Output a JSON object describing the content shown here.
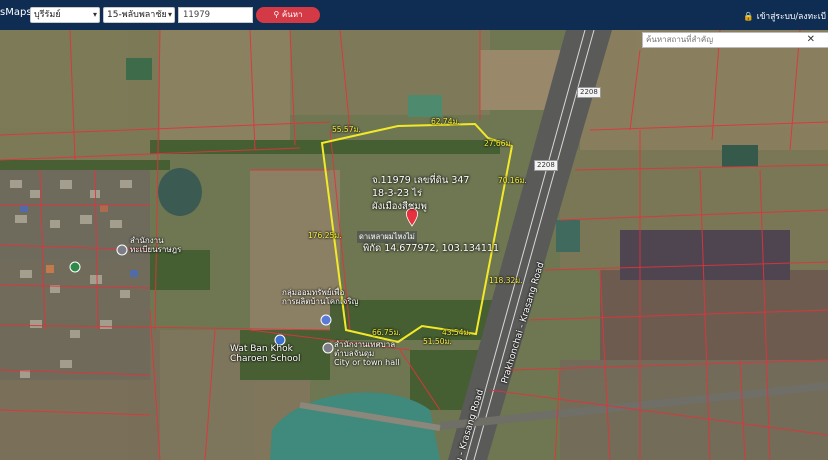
{
  "header": {
    "brand": "sMaps",
    "province_select": "บุรีรัมย์",
    "district_select": "15-พลับพลาชัย",
    "parcel_number": "11979",
    "search_button": "ค้นหา",
    "login_label": "เข้าสู่ระบบ/ลงทะเบี"
  },
  "map": {
    "place_search_placeholder": "ค้นหาสถานที่สำคัญ",
    "parcel_info": {
      "line1": "จ.11979 เลขที่ดิน 347",
      "line2": "18-3-23 ไร่",
      "line3": "ผังเมืองสีชมพู",
      "coords": "พิกัด 14.677972, 103.134111"
    },
    "marker_label": "ดาเหลาผมไหงไม่",
    "dimensions": [
      "55.57ม.",
      "62.74ม.",
      "27.66ม.",
      "70.16ม.",
      "176.25ม.",
      "118.32ม.",
      "66.75ม.",
      "43.54ม.",
      "51.50ม."
    ],
    "road_shields": [
      "2208",
      "2208"
    ],
    "road_names": [
      "Prakhonchai - Krasang Road",
      "u - Krasang Road"
    ],
    "poi_labels": {
      "poi_1": "สำนักงาน\nทะเบียนราษฎร",
      "poi_2": "กลุ่มออมทรัพย์เพื่อ\nการผลิตบ้านโคกเจริญ",
      "school": "Wat Ban Khok\nCharoen School",
      "city_hall": "สำนักงานเทศบาล\nตำบลจันดุม\nCity or town hall"
    },
    "parcel_color": "#f2e928",
    "marker_color": "#e8313e"
  }
}
